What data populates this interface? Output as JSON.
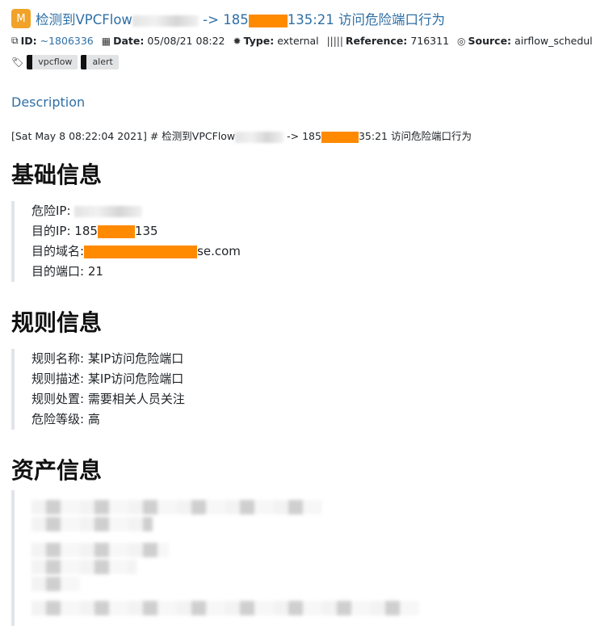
{
  "header": {
    "badge": "M",
    "title_prefix": "检测到VPCFlow",
    "title_mid": " -> 185",
    "title_suffix": "135:21 访问危险端口行为"
  },
  "meta": {
    "id_label": "ID:",
    "id_value": "~1806336",
    "date_label": "Date:",
    "date_value": "05/08/21 08:22",
    "type_label": "Type:",
    "type_value": "external",
    "ref_label": "Reference:",
    "ref_value": "716311",
    "source_label": "Source:",
    "source_value": "airflow_scheduler"
  },
  "tags": [
    "vpcflow",
    "alert"
  ],
  "description": {
    "heading": "Description",
    "line_prefix": "[Sat May 8 08:22:04 2021] # 检测到VPCFlow",
    "line_mid": " -> 185",
    "line_suffix": "35:21 访问危险端口行为"
  },
  "basic": {
    "heading": "基础信息",
    "danger_ip_label": "危险IP: ",
    "dest_ip_label": "目的IP: 185",
    "dest_ip_tail": "135",
    "domain_label": "目的域名:",
    "domain_tail": "se.com",
    "port_line": "目的端口: 21"
  },
  "rule": {
    "heading": "规则信息",
    "lines": [
      "规则名称: 某IP访问危险端口",
      "规则描述: 某IP访问危险端口",
      "规则处置: 需要相关人员关注",
      "危险等级: 高"
    ]
  },
  "asset": {
    "heading": "资产信息"
  }
}
